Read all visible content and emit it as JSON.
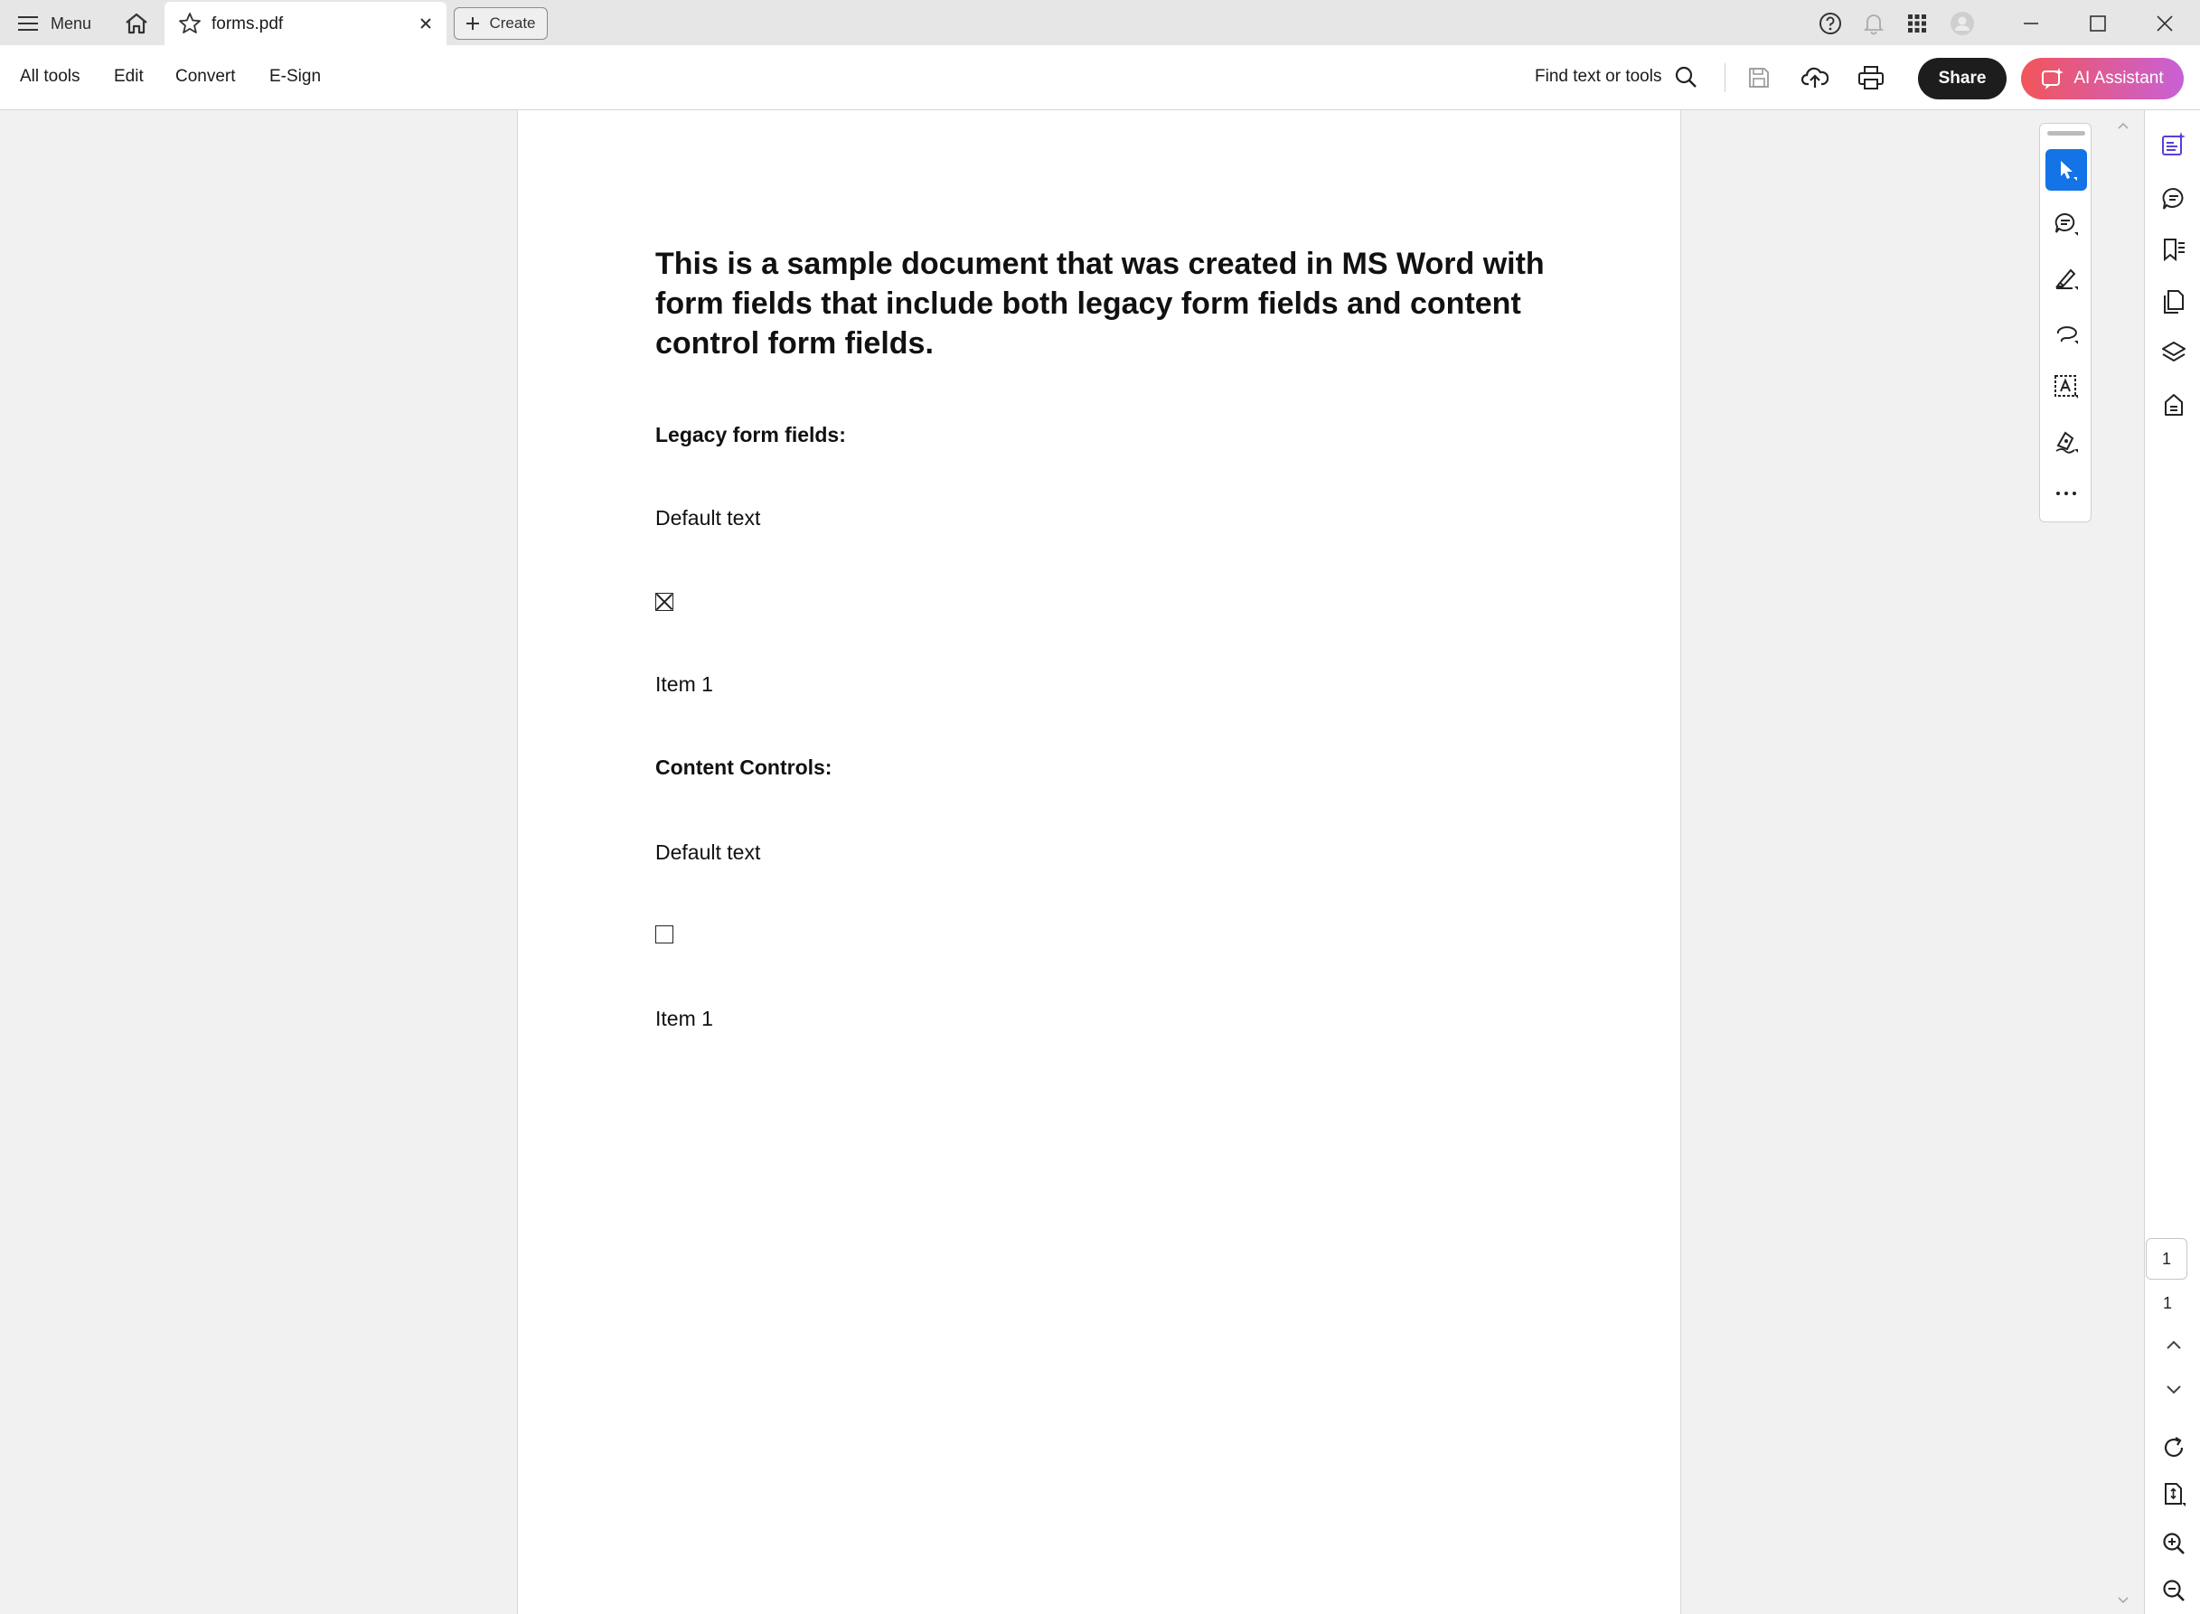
{
  "titlebar": {
    "menu_label": "Menu",
    "tab_label": "forms.pdf",
    "create_label": "Create"
  },
  "toolbar": {
    "nav": [
      "All tools",
      "Edit",
      "Convert",
      "E-Sign"
    ],
    "find_label": "Find text or tools",
    "share_label": "Share",
    "ai_label": "AI Assistant"
  },
  "document": {
    "title": "This is a sample document that was created in MS Word with form fields that include both legacy form fields and content control form fields.",
    "legacy_heading": "Legacy form fields:",
    "legacy_text": "Default text",
    "legacy_checkbox_checked": true,
    "legacy_dropdown": "Item 1",
    "content_heading": "Content Controls:",
    "content_text": "Default text",
    "content_checkbox_checked": false,
    "content_dropdown": "Item 1"
  },
  "pagination": {
    "current_page": "1",
    "total_pages": "1"
  },
  "colors": {
    "accent": "#1473e6",
    "share_bg": "#1d1d1d",
    "ai_gradient_start": "#f2555a",
    "ai_gradient_end": "#c861d6"
  }
}
